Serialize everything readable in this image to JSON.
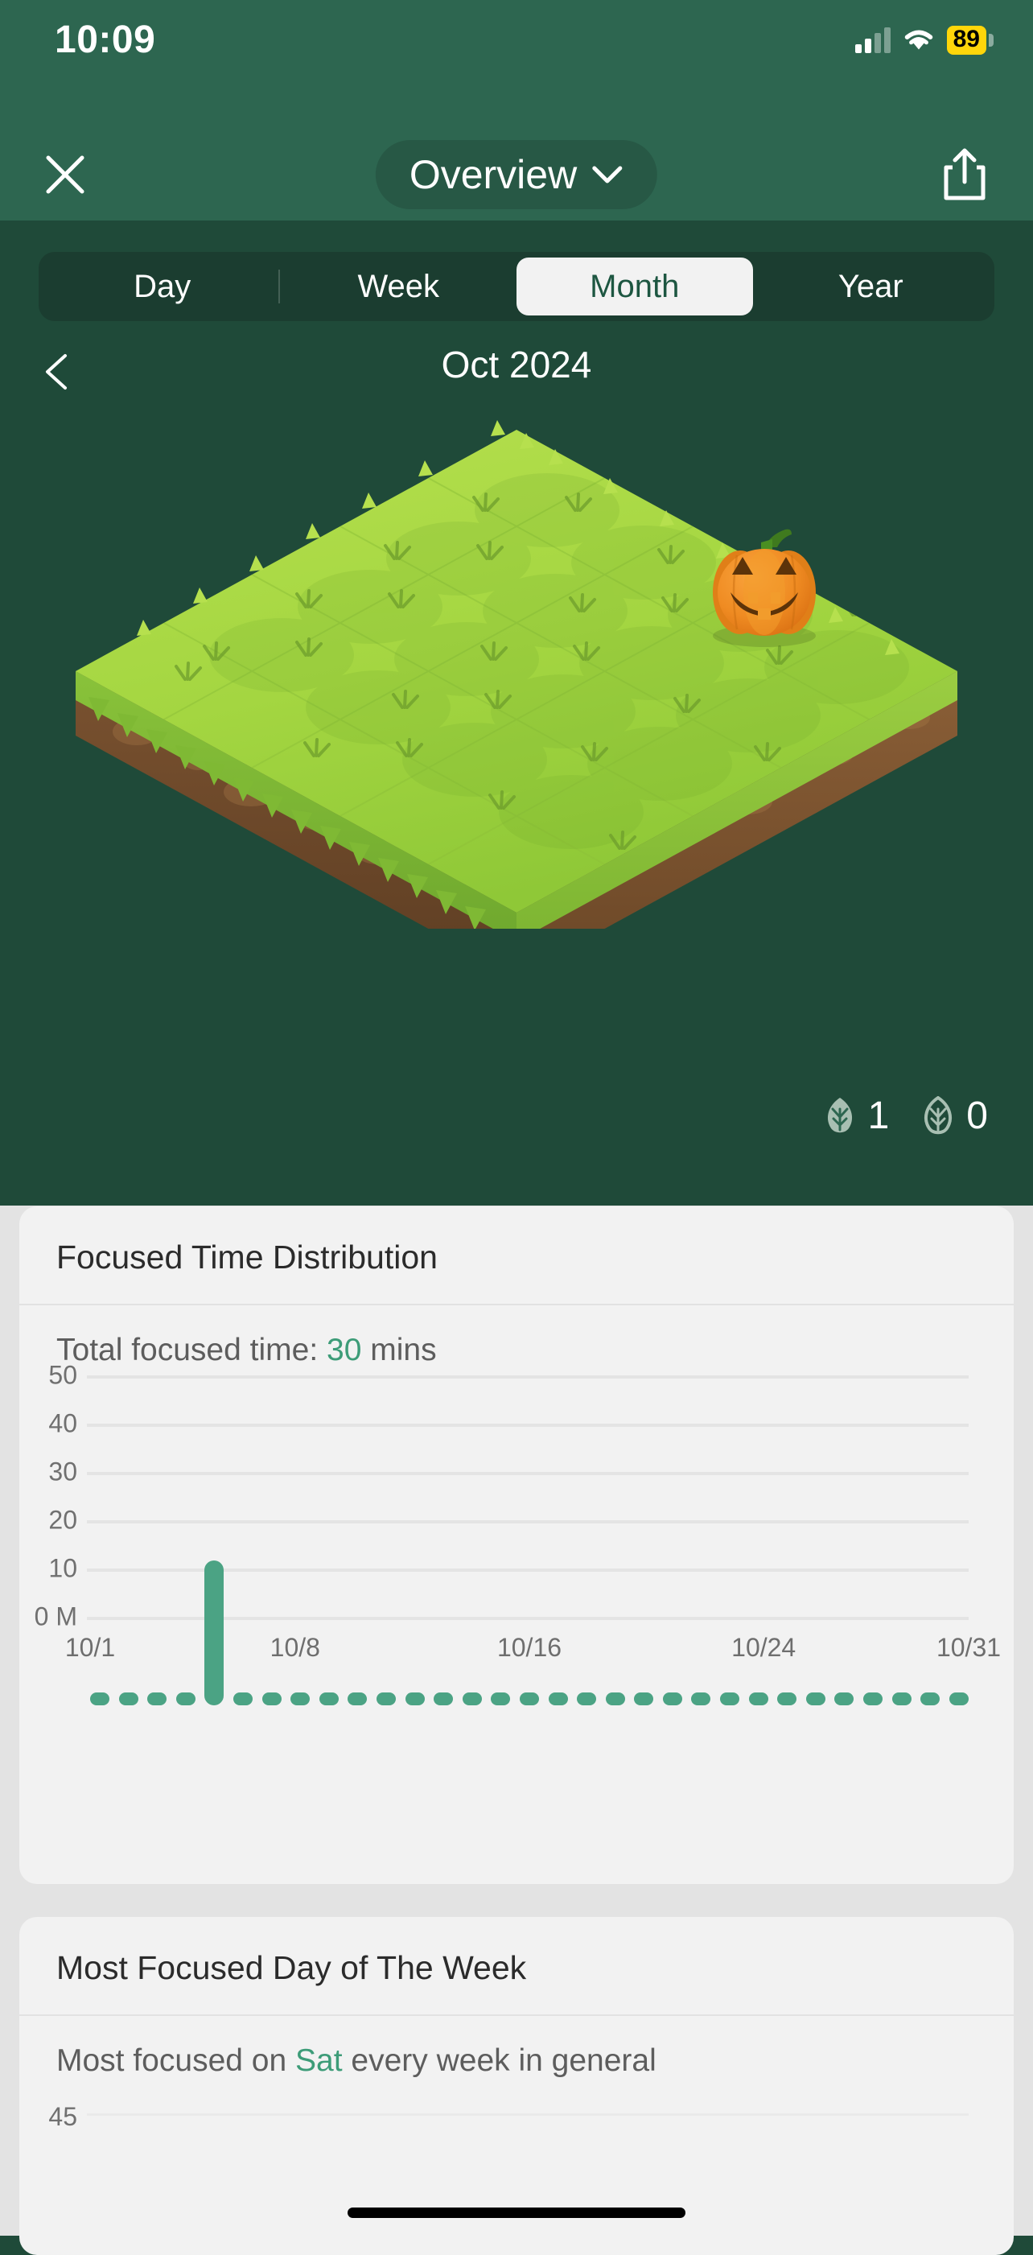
{
  "status_bar": {
    "time": "10:09",
    "battery_percent": "89",
    "cellular_icon": "cellular-signal-icon",
    "wifi_icon": "wifi-icon",
    "battery_color": "#ffd60a"
  },
  "nav": {
    "close_icon": "close-x-icon",
    "title": "Overview",
    "chevron_icon": "chevron-down-icon",
    "share_icon": "share-icon"
  },
  "segmented": {
    "options": [
      "Day",
      "Week",
      "Month",
      "Year"
    ],
    "selected": "Month"
  },
  "period": {
    "prev_icon": "chevron-left-icon",
    "label": "Oct 2024"
  },
  "plot": {
    "decoration": "jack-o-lantern-pumpkin",
    "grid_rows": 5,
    "grid_cols": 5,
    "grass_color": "#9ed23f",
    "soil_color": "#7a5230"
  },
  "counters": [
    {
      "icon": "leaf-filled-icon",
      "value": "1"
    },
    {
      "icon": "leaf-outline-icon",
      "value": "0"
    }
  ],
  "cards": {
    "distribution": {
      "title": "Focused Time Distribution",
      "subtitle_prefix": "Total focused time: ",
      "subtitle_value": "30",
      "subtitle_suffix": " mins"
    },
    "weekday": {
      "title": "Most Focused Day of The Week",
      "subtitle_prefix": "Most focused on ",
      "subtitle_value": "Sat",
      "subtitle_suffix": " every week in general",
      "y_tick": "45"
    }
  },
  "accent_color": "#3d9c78",
  "chart_data": [
    {
      "type": "bar",
      "id": "focused-time-distribution",
      "title": "Focused Time Distribution",
      "xlabel": "",
      "ylabel": "0 M",
      "ylim": [
        0,
        50
      ],
      "yticks": [
        "0 M",
        "10",
        "20",
        "30",
        "40",
        "50"
      ],
      "ytick_values": [
        0,
        10,
        20,
        30,
        40,
        50
      ],
      "grid": true,
      "legend": "none",
      "categories": [
        "10/1",
        "10/2",
        "10/3",
        "10/4",
        "10/5",
        "10/6",
        "10/7",
        "10/8",
        "10/9",
        "10/10",
        "10/11",
        "10/12",
        "10/13",
        "10/14",
        "10/15",
        "10/16",
        "10/17",
        "10/18",
        "10/19",
        "10/20",
        "10/21",
        "10/22",
        "10/23",
        "10/24",
        "10/25",
        "10/26",
        "10/27",
        "10/28",
        "10/29",
        "10/30",
        "10/31"
      ],
      "xtick_labels": [
        "10/1",
        "10/8",
        "10/16",
        "10/24",
        "10/31"
      ],
      "xtick_indices": [
        0,
        7,
        15,
        23,
        30
      ],
      "values": [
        0,
        0,
        0,
        0,
        30,
        0,
        0,
        0,
        0,
        0,
        0,
        0,
        0,
        0,
        0,
        0,
        0,
        0,
        0,
        0,
        0,
        0,
        0,
        0,
        0,
        0,
        0,
        0,
        0,
        0,
        0
      ],
      "bar_color": "#4ba384",
      "total_focused_minutes": 30
    },
    {
      "type": "bar",
      "id": "most-focused-day-of-week",
      "title": "Most Focused Day of The Week",
      "annotation": "Most focused on Sat every week in general",
      "ylim": [
        0,
        45
      ],
      "yticks": [
        "45"
      ],
      "ytick_values": [
        45
      ],
      "grid": true,
      "categories": [],
      "values": [],
      "bar_color": "#4ba384"
    }
  ]
}
